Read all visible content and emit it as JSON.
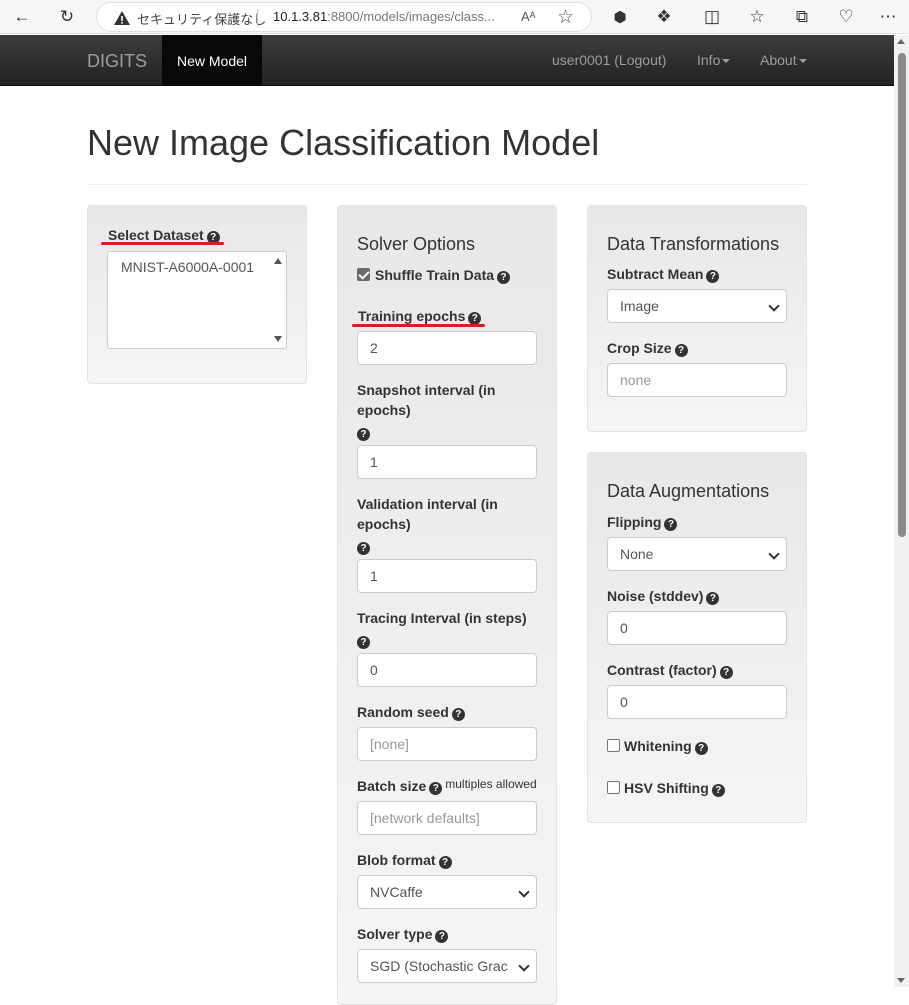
{
  "browser": {
    "security_label": "セキュリティ保護なし",
    "url_host": "10.1.3.81",
    "url_rest": ":8800/models/images/class...",
    "read_aloud": "Aᴬ"
  },
  "navbar": {
    "brand": "DIGITS",
    "active_item": "New Model",
    "user": "user0001 (Logout)",
    "info": "Info",
    "about": "About"
  },
  "page": {
    "title": "New Image Classification Model"
  },
  "dataset_panel": {
    "label": "Select Dataset",
    "options": [
      "MNIST-A6000A-0001"
    ]
  },
  "solver_panel": {
    "heading": "Solver Options",
    "shuffle_label": "Shuffle Train Data",
    "shuffle_checked": true,
    "epochs_label": "Training epochs",
    "epochs_value": "2",
    "snapshot_label_1": "Snapshot interval (in",
    "snapshot_label_2": "epochs)",
    "snapshot_value": "1",
    "validation_label_1": "Validation interval (in",
    "validation_label_2": "epochs)",
    "validation_value": "1",
    "tracing_label": "Tracing Interval (in steps)",
    "tracing_value": "0",
    "seed_label": "Random seed",
    "seed_placeholder": "[none]",
    "batch_label": "Batch size",
    "batch_note": "multiples allowed",
    "batch_placeholder": "[network defaults]",
    "blob_label": "Blob format",
    "blob_value": "NVCaffe",
    "solver_type_label": "Solver type",
    "solver_type_value": "SGD (Stochastic Grac"
  },
  "transform_panel": {
    "heading": "Data Transformations",
    "subtract_label": "Subtract Mean",
    "subtract_value": "Image",
    "crop_label": "Crop Size",
    "crop_placeholder": "none"
  },
  "augment_panel": {
    "heading": "Data Augmentations",
    "flipping_label": "Flipping",
    "flipping_value": "None",
    "noise_label": "Noise (stddev)",
    "noise_value": "0",
    "contrast_label": "Contrast (factor)",
    "contrast_value": "0",
    "whitening_label": "Whitening",
    "whitening_checked": false,
    "hsv_label": "HSV Shifting",
    "hsv_checked": false
  },
  "help_icon_glyph": "?",
  "colors": {
    "navbar": "#222222",
    "annotation_underline": "#d81e1e"
  }
}
